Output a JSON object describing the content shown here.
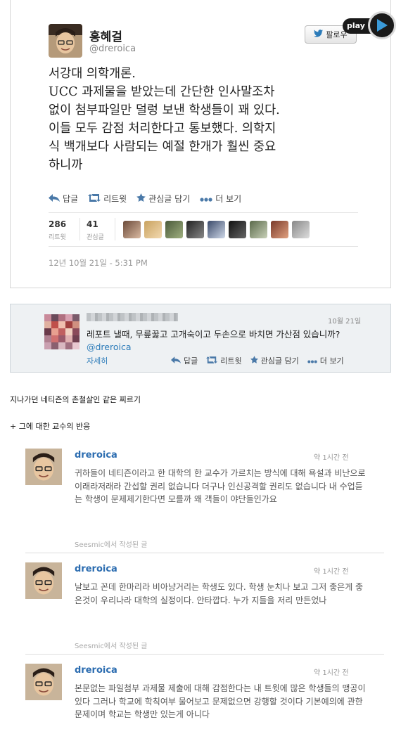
{
  "main_tweet": {
    "name": "홍혜걸",
    "handle": "@dreroica",
    "follow_label": "팔로우",
    "play_label": "play",
    "text": "서강대 의학개론.\nUCC 과제물을 받았는데 간단한 인사말조차\n없이 첨부파일만 덜렁 보낸 학생들이 꽤 있다.\n이들 모두 감점 처리한다고 통보했다. 의학지\n식 백개보다 사람되는 예절 한개가 훨씬 중요\n하니까",
    "actions": {
      "reply": "답글",
      "retweet": "리트윗",
      "favorite": "관심글 담기",
      "more": "더 보기"
    },
    "stats": {
      "retweets": "286",
      "retweets_label": "리트윗",
      "favorites": "41",
      "favorites_label": "관심글"
    },
    "date": "12년 10월 21일 - 5:31 PM"
  },
  "reply_tweet": {
    "date": "10월 21일",
    "text": "레포트 낼때, 무릎꿇고 고개숙이고 두손으로 바치면 가산점 있습니까?",
    "mention": "@dreroica",
    "detail": "자세히",
    "actions": {
      "reply": "답글",
      "retweet": "리트윗",
      "favorite": "관심글 담기",
      "more": "더 보기"
    }
  },
  "captions": {
    "first": "지나가던 네티즌의 촌철살인 같은 찌르기",
    "second": "+ 그에 대한 교수의 반응"
  },
  "comments": [
    {
      "name": "dreroica",
      "time": "약 1시간 전",
      "text": "귀하들이 네티즌이라고 한 대학의 한 교수가 가르치는 방식에 대해 욕설과 비난으로 이래라저래라 간섭할 권리 없습니다 더구나 인신공격할 권리도 없습니다 내 수업듣는 학생이 문제제기한다면 모를까 왜 객들이 야단들인가요",
      "via": "Seesmic에서 작성된 글"
    },
    {
      "name": "dreroica",
      "time": "약 1시간 전",
      "text": "날보고 꼰데 한마리라 비아냥거리는 학생도 있다. 학생 눈치나 보고 그저 좋은게 좋은것이 우리나라 대학의 실정이다. 안타깝다. 누가 지들을 저리 만든었나",
      "via": "Seesmic에서 작성된 글"
    },
    {
      "name": "dreroica",
      "time": "약 1시간 전",
      "text": "본문없는 파일첨부 과제물 제출에 대해 감점한다는 내 트윗에 많은 학생들의 맹공이 있다 그러나 학교에 학칙여부 물어보고 문제없으면 강행할 것이다 기본예의에 관한 문제이며 학교는 학생만 있는게 아니다",
      "via": ""
    }
  ],
  "colors": {
    "link": "#2b7bb9",
    "reply_bg": "#eef1f3",
    "name_blue": "#2b6cb0"
  }
}
